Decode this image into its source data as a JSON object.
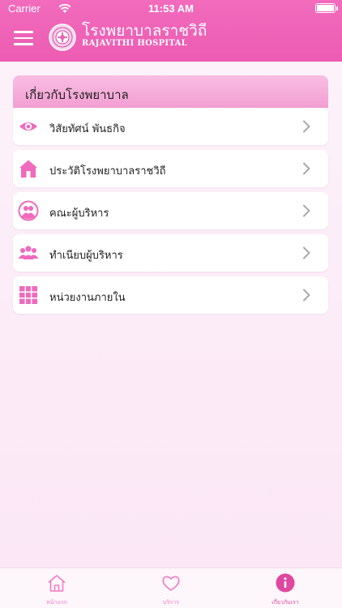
{
  "status_bar": {
    "carrier": "Carrier",
    "time": "11:53 AM"
  },
  "header": {
    "brand_thai": "โรงพยาบาลราชวิถี",
    "brand_english": "RAJAVITHI HOSPITAL"
  },
  "section": {
    "title": "เกี่ยวกับโรงพยาบาล"
  },
  "menu": [
    {
      "label": "วิสัยทัศน์ พันธกิจ",
      "icon": "eye-icon"
    },
    {
      "label": "ประวัติโรงพยาบาลราชวิถี",
      "icon": "home-icon"
    },
    {
      "label": "คณะผู้บริหาร",
      "icon": "people-circle-icon"
    },
    {
      "label": "ทำเนียบผู้บริหาร",
      "icon": "group-icon"
    },
    {
      "label": "หน่วยงานภายใน",
      "icon": "grid-icon"
    }
  ],
  "tabbar": {
    "tabs": [
      {
        "label": "หน้าแรก",
        "icon": "home-outline-icon"
      },
      {
        "label": "บริการ",
        "icon": "heart-outline-icon"
      },
      {
        "label": "เกี่ยวกับเรา",
        "icon": "info-icon"
      }
    ]
  },
  "colors": {
    "accent": "#ee5fb5",
    "icon_pink": "#f06abd",
    "section_bg": "#f6b0dd"
  }
}
